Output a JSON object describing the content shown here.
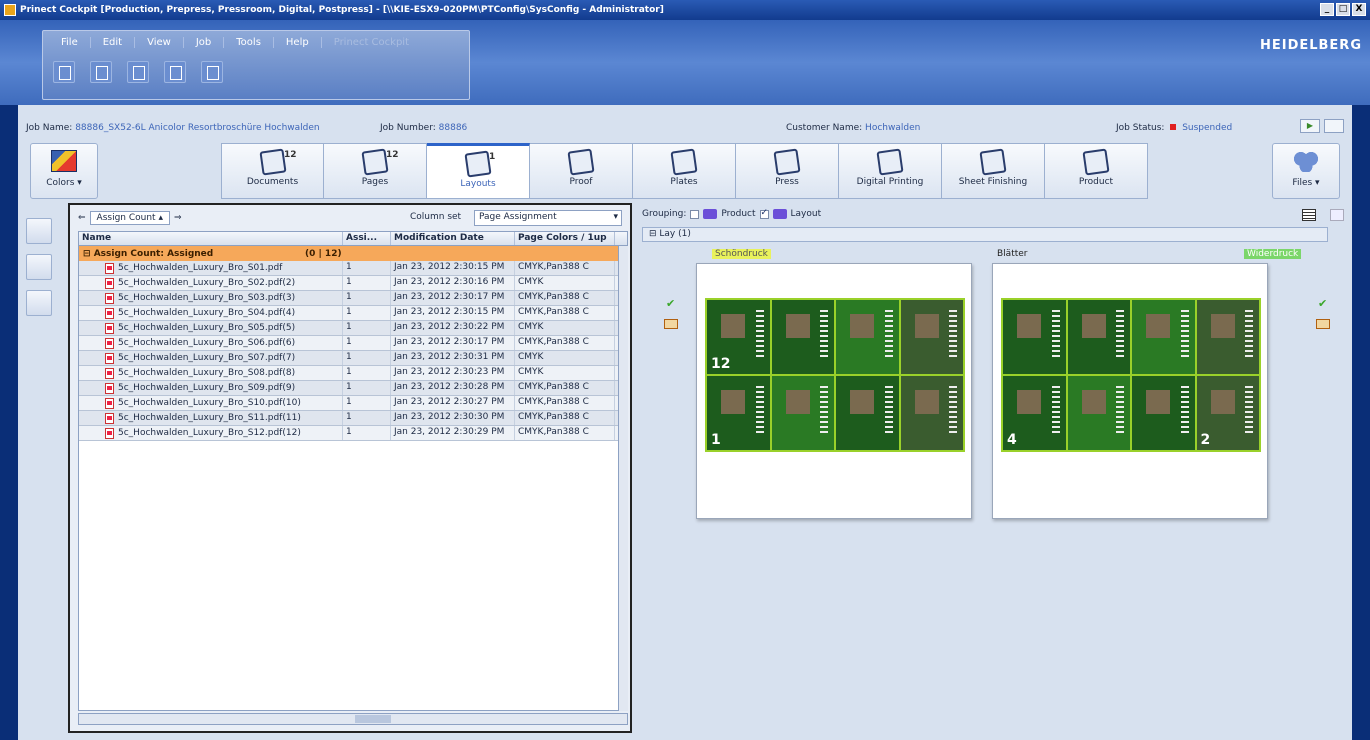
{
  "window": {
    "title": "Prinect Cockpit [Production, Prepress, Pressroom, Digital, Postpress] - [\\\\KIE-ESX9-020PM\\PTConfig\\SysConfig - Administrator]",
    "buttons": [
      "_",
      "□",
      "X"
    ]
  },
  "menu": {
    "items": [
      "File",
      "Edit",
      "View",
      "Job",
      "Tools",
      "Help"
    ],
    "app_label": "Prinect Cockpit"
  },
  "toolbar_icons": [
    "job-icon",
    "chart-icon",
    "users-icon",
    "print-icon",
    "save-icon"
  ],
  "brand": {
    "logo": "HEIDELBERG"
  },
  "job": {
    "name_label": "Job Name:",
    "name_value": "88886_SX52-6L Anicolor Resortbroschüre Hochwalden",
    "number_label": "Job Number:",
    "number_value": "88886",
    "customer_label": "Customer Name:",
    "customer_value": "Hochwalden",
    "status_label": "Job Status:",
    "status_value": "Suspended",
    "status_color": "#e02020"
  },
  "workflow": {
    "colors_label": "Colors",
    "files_label": "Files",
    "steps": [
      {
        "label": "Documents",
        "count": "12"
      },
      {
        "label": "Pages",
        "count": "12"
      },
      {
        "label": "Layouts",
        "count": "1"
      },
      {
        "label": "Proof",
        "count": ""
      },
      {
        "label": "Plates",
        "count": ""
      },
      {
        "label": "Press",
        "count": ""
      },
      {
        "label": "Digital Printing",
        "count": ""
      },
      {
        "label": "Sheet Finishing",
        "count": ""
      },
      {
        "label": "Product",
        "count": ""
      }
    ],
    "active_step": "Layouts"
  },
  "left_panel": {
    "filter_chip": "Assign Count",
    "column_set_label": "Column set",
    "column_set_value": "Page Assignment",
    "columns": [
      "Name",
      "Assi...",
      "Modification Date",
      "Page Colors / 1up"
    ],
    "group": {
      "label": "Assign Count: Assigned",
      "count": "(0 | 12)"
    },
    "rows": [
      {
        "name": "5c_Hochwalden_Luxury_Bro_S01.pdf",
        "assign": "1",
        "date": "Jan 23, 2012 2:30:15 PM",
        "colors": "CMYK,Pan388 C"
      },
      {
        "name": "5c_Hochwalden_Luxury_Bro_S02.pdf(2)",
        "assign": "1",
        "date": "Jan 23, 2012 2:30:16 PM",
        "colors": "CMYK"
      },
      {
        "name": "5c_Hochwalden_Luxury_Bro_S03.pdf(3)",
        "assign": "1",
        "date": "Jan 23, 2012 2:30:17 PM",
        "colors": "CMYK,Pan388 C"
      },
      {
        "name": "5c_Hochwalden_Luxury_Bro_S04.pdf(4)",
        "assign": "1",
        "date": "Jan 23, 2012 2:30:15 PM",
        "colors": "CMYK,Pan388 C"
      },
      {
        "name": "5c_Hochwalden_Luxury_Bro_S05.pdf(5)",
        "assign": "1",
        "date": "Jan 23, 2012 2:30:22 PM",
        "colors": "CMYK"
      },
      {
        "name": "5c_Hochwalden_Luxury_Bro_S06.pdf(6)",
        "assign": "1",
        "date": "Jan 23, 2012 2:30:17 PM",
        "colors": "CMYK,Pan388 C"
      },
      {
        "name": "5c_Hochwalden_Luxury_Bro_S07.pdf(7)",
        "assign": "1",
        "date": "Jan 23, 2012 2:30:31 PM",
        "colors": "CMYK"
      },
      {
        "name": "5c_Hochwalden_Luxury_Bro_S08.pdf(8)",
        "assign": "1",
        "date": "Jan 23, 2012 2:30:23 PM",
        "colors": "CMYK"
      },
      {
        "name": "5c_Hochwalden_Luxury_Bro_S09.pdf(9)",
        "assign": "1",
        "date": "Jan 23, 2012 2:30:28 PM",
        "colors": "CMYK,Pan388 C"
      },
      {
        "name": "5c_Hochwalden_Luxury_Bro_S10.pdf(10)",
        "assign": "1",
        "date": "Jan 23, 2012 2:30:27 PM",
        "colors": "CMYK,Pan388 C"
      },
      {
        "name": "5c_Hochwalden_Luxury_Bro_S11.pdf(11)",
        "assign": "1",
        "date": "Jan 23, 2012 2:30:30 PM",
        "colors": "CMYK,Pan388 C"
      },
      {
        "name": "5c_Hochwalden_Luxury_Bro_S12.pdf(12)",
        "assign": "1",
        "date": "Jan 23, 2012 2:30:29 PM",
        "colors": "CMYK,Pan388 C"
      }
    ]
  },
  "right_panel": {
    "grouping_label": "Grouping:",
    "product_label": "Product",
    "layout_label": "Layout",
    "lay_label": "Lay (1)",
    "front_label": "Schöndruck",
    "mid_label": "Blätter",
    "back_label": "Widerdruck",
    "front_pages": [
      "12",
      "",
      "",
      "",
      "1",
      "",
      "",
      ""
    ],
    "back_pages": [
      "",
      "",
      "",
      "",
      "4",
      "",
      "",
      "2"
    ]
  }
}
